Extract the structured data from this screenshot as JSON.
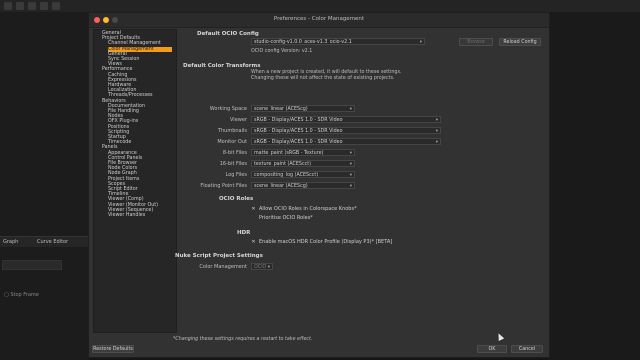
{
  "window": {
    "title": "Preferences - Color Management"
  },
  "background": {
    "tabs": [
      "Graph",
      "Curve Editor"
    ],
    "check_label": "Stop Frame"
  },
  "tree": [
    {
      "label": "General",
      "indent": 0,
      "selected": false
    },
    {
      "label": "Project Defaults",
      "indent": 0,
      "selected": false
    },
    {
      "label": "Channel Management",
      "indent": 1,
      "selected": false
    },
    {
      "label": "Color Management",
      "indent": 1,
      "selected": true
    },
    {
      "label": "General",
      "indent": 1,
      "selected": false
    },
    {
      "label": "Sync Session",
      "indent": 1,
      "selected": false
    },
    {
      "label": "Views",
      "indent": 1,
      "selected": false
    },
    {
      "label": "Performance",
      "indent": 0,
      "selected": false
    },
    {
      "label": "Caching",
      "indent": 1,
      "selected": false
    },
    {
      "label": "Expressions",
      "indent": 1,
      "selected": false
    },
    {
      "label": "Hardware",
      "indent": 1,
      "selected": false
    },
    {
      "label": "Localization",
      "indent": 1,
      "selected": false
    },
    {
      "label": "Threads/Processes",
      "indent": 1,
      "selected": false
    },
    {
      "label": "Behaviors",
      "indent": 0,
      "selected": false
    },
    {
      "label": "Documentation",
      "indent": 1,
      "selected": false
    },
    {
      "label": "File Handling",
      "indent": 1,
      "selected": false
    },
    {
      "label": "Nodes",
      "indent": 1,
      "selected": false
    },
    {
      "label": "OFX Plug-ins",
      "indent": 1,
      "selected": false
    },
    {
      "label": "Positions",
      "indent": 1,
      "selected": false
    },
    {
      "label": "Scripting",
      "indent": 1,
      "selected": false
    },
    {
      "label": "Startup",
      "indent": 1,
      "selected": false
    },
    {
      "label": "Timecode",
      "indent": 1,
      "selected": false
    },
    {
      "label": "Panels",
      "indent": 0,
      "selected": false
    },
    {
      "label": "Appearance",
      "indent": 1,
      "selected": false
    },
    {
      "label": "Control Panels",
      "indent": 1,
      "selected": false
    },
    {
      "label": "File Browser",
      "indent": 1,
      "selected": false
    },
    {
      "label": "Node Colors",
      "indent": 1,
      "selected": false
    },
    {
      "label": "Node Graph",
      "indent": 1,
      "selected": false
    },
    {
      "label": "Project Items",
      "indent": 1,
      "selected": false
    },
    {
      "label": "Scopes",
      "indent": 1,
      "selected": false
    },
    {
      "label": "Script Editor",
      "indent": 1,
      "selected": false
    },
    {
      "label": "Timeline",
      "indent": 1,
      "selected": false
    },
    {
      "label": "Viewer (Comp)",
      "indent": 1,
      "selected": false
    },
    {
      "label": "Viewer (Monitor Out)",
      "indent": 1,
      "selected": false
    },
    {
      "label": "Viewer (Sequence)",
      "indent": 1,
      "selected": false
    },
    {
      "label": "Viewer Handles",
      "indent": 1,
      "selected": false
    }
  ],
  "ocio_config": {
    "heading": "Default OCIO Config",
    "value": "studio-config-v1.0.0_aces-v1.3_ocio-v2.1",
    "version": "OCIO config Version: v2.1",
    "browse_label": "Browse",
    "reload_label": "Reload Config"
  },
  "transforms": {
    "heading": "Default Color Transforms",
    "note": "When a new project is created, it will default to these settings.\nChanging these will not affect the state of existing projects.",
    "rows": [
      {
        "label": "Working Space",
        "value": "scene_linear (ACEScg)"
      },
      {
        "label": "Viewer",
        "value": "sRGB - Display/ACES 1.0 - SDR Video"
      },
      {
        "label": "Thumbnails",
        "value": "sRGB - Display/ACES 1.0 - SDR Video"
      },
      {
        "label": "Monitor Out",
        "value": "sRGB - Display/ACES 1.0 - SDR Video"
      },
      {
        "label": "8-bit Files",
        "value": "matte_paint (sRGB - Texture)"
      },
      {
        "label": "16-bit Files",
        "value": "texture_paint (ACEScct)"
      },
      {
        "label": "Log Files",
        "value": "compositing_log (ACEScct)"
      },
      {
        "label": "Floating Point Files",
        "value": "scene_linear (ACEScg)"
      }
    ]
  },
  "ocio_roles": {
    "heading": "OCIO Roles",
    "options": [
      {
        "label": "Allow OCIO Roles in Colorspace Knobs*",
        "checked": true
      },
      {
        "label": "Prioritise OCIO Roles*",
        "checked": false
      }
    ]
  },
  "hdr": {
    "heading": "HDR",
    "option": {
      "label": "Enable macOS HDR Color Profile (Display P3)* [BETA]",
      "checked": true
    }
  },
  "nuke_script": {
    "heading": "Nuke Script Project Settings",
    "color_management_label": "Color Management",
    "color_management_value": "OCIO"
  },
  "footer": {
    "note": "*Changing these settings requires a restart to take effect.",
    "restore_label": "Restore Defaults",
    "ok_label": "OK",
    "cancel_label": "Cancel"
  },
  "colors": {
    "accent": "#f29a1b",
    "dialog_bg": "#323232",
    "tree_bg": "#262626"
  }
}
